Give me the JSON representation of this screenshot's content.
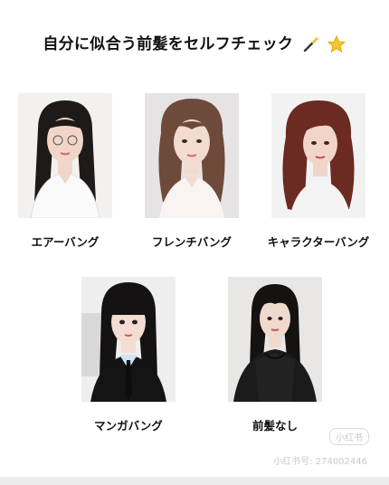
{
  "title": "自分に似合う前髪をセルフチェック",
  "title_icons": [
    "magic-wand-icon",
    "star-icon"
  ],
  "styles": [
    {
      "label": "エアーバング"
    },
    {
      "label": "フレンチバング"
    },
    {
      "label": "キャラクターバング"
    },
    {
      "label": "マンガバング"
    },
    {
      "label": "前髪なし"
    }
  ],
  "watermark": {
    "badge": "小红书",
    "id": "小红书号: 274002446"
  },
  "colors": {
    "text": "#111111",
    "dark_hair": "#1f1a1a",
    "brown_hair": "#6e4a3a",
    "auburn_hair": "#6b2a22",
    "skin": "#f1d6c8"
  }
}
